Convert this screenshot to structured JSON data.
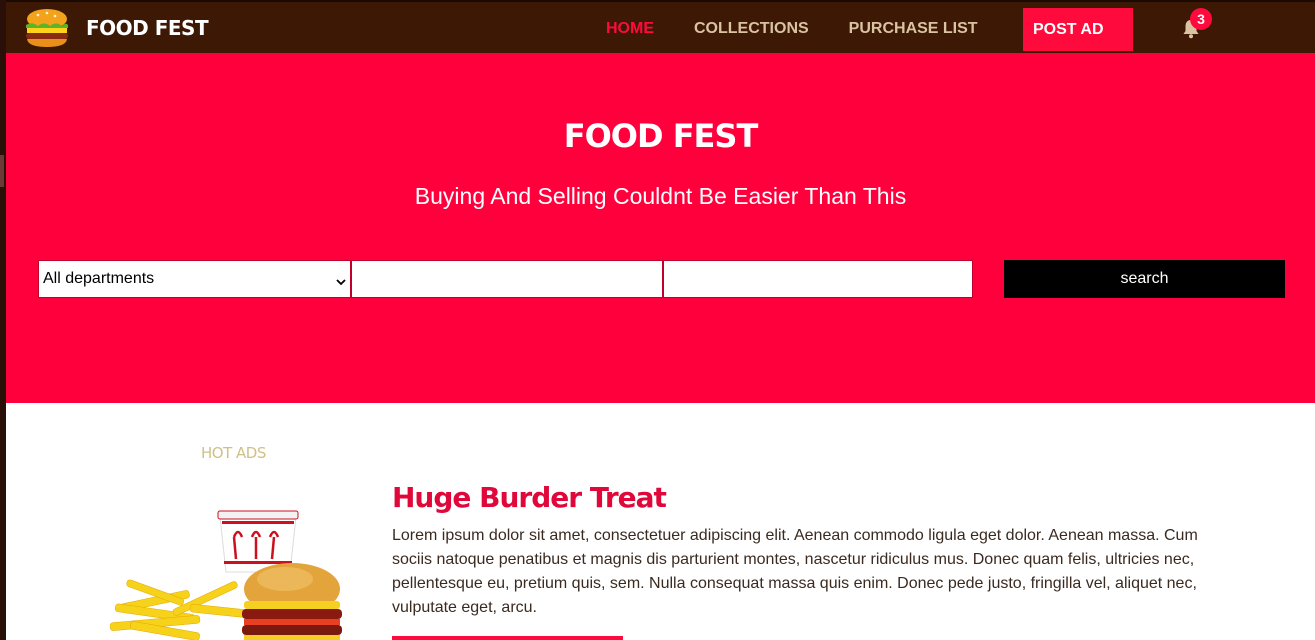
{
  "navbar": {
    "brand": "FOOD FEST",
    "links": [
      {
        "label": "HOME",
        "active": true
      },
      {
        "label": "COLLECTIONS",
        "active": false
      },
      {
        "label": "PURCHASE LIST",
        "active": false
      }
    ],
    "post_ad": "POST AD",
    "notification_count": "3",
    "icons": {
      "logo": "burger-logo-icon",
      "notifications": "bell-icon"
    }
  },
  "hero": {
    "title": "FOOD FEST",
    "subtitle": "Buying And Selling Couldnt Be Easier Than This",
    "department_select": {
      "selected": "All departments"
    },
    "search_button": "search"
  },
  "content": {
    "section_label": "HOT ADS",
    "ad": {
      "title": "Huge Burder Treat",
      "description": "Lorem ipsum dolor sit amet, consectetuer adipiscing elit. Aenean commodo ligula eget dolor. Aenean massa. Cum sociis natoque penatibus et magnis dis parturient montes, nascetur ridiculus mus. Donec quam felis, ultricies nec, pellentesque eu, pretium quis, sem. Nulla consequat massa quis enim. Donec pede justo, fringilla vel, aliquet nec, vulputate eget, arcu."
    }
  },
  "colors": {
    "navbar_bg": "#3d1805",
    "accent": "#ff003c",
    "nav_text": "#d9c3a0",
    "label_gold": "#cfc089"
  }
}
